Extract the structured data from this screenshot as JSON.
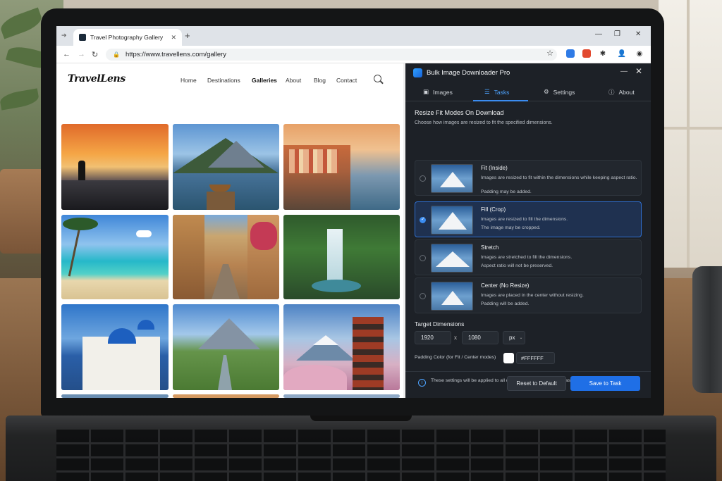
{
  "browser": {
    "tab_title": "Travel Photography Gallery",
    "url": "https://www.travellens.com/gallery"
  },
  "site": {
    "logo": "TravelLens",
    "nav": [
      "Home",
      "Destinations",
      "Galleries",
      "About",
      "Blog",
      "Contact"
    ],
    "active_nav": "Galleries"
  },
  "panel": {
    "title": "Bulk Image Downloader Pro",
    "tabs": [
      "Images",
      "Tasks",
      "Settings",
      "About"
    ],
    "active_tab": "Tasks",
    "section_title": "Resize Fit Modes On Download",
    "section_sub": "Choose how images are resized to fit the specified dimensions.",
    "options": [
      {
        "name": "Fit (Inside)",
        "desc": "Images are resized to fit within the dimensions while keeping aspect ratio.",
        "desc2": "Padding may be added.",
        "selected": false
      },
      {
        "name": "Fill (Crop)",
        "desc": "Images are resized to fill the dimensions.",
        "desc2": "The image may be cropped.",
        "selected": true
      },
      {
        "name": "Stretch",
        "desc": "Images are stretched to fill the dimensions.",
        "desc2": "Aspect ratio will not be preserved.",
        "selected": false
      },
      {
        "name": "Center (No Resize)",
        "desc": "Images are placed in the center without resizing.",
        "desc2": "Padding will be added.",
        "selected": false
      }
    ],
    "dimensions_title": "Target Dimensions",
    "width": "1920",
    "x_label": "x",
    "height": "1080",
    "unit": "px",
    "padding_label": "Padding Color (for Fit / Center modes)",
    "padding_color": "#FFFFFF",
    "info": "These settings will be applied to all downloaded images in this task.",
    "reset_label": "Reset to Default",
    "save_label": "Save to Task"
  }
}
